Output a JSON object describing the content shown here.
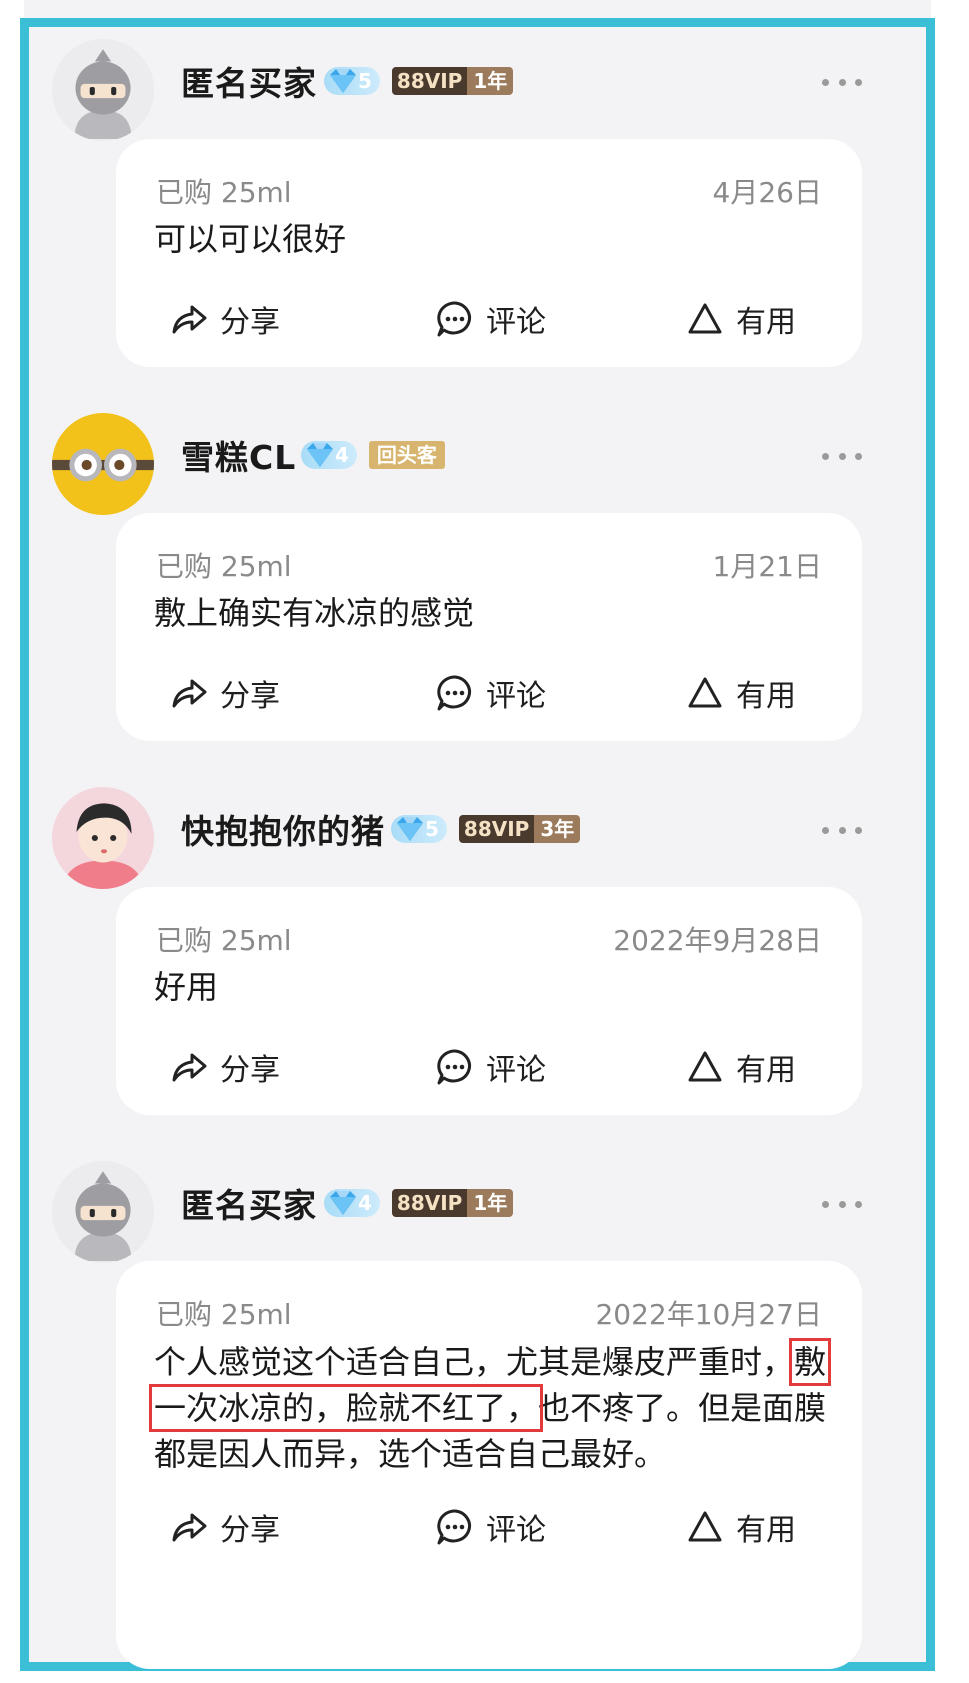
{
  "reviews": [
    {
      "username": "匿名买家",
      "diamond_level": "5",
      "vip_label": "88VIP",
      "vip_years": "1年",
      "purchase": "已购 25ml",
      "date": "4月26日",
      "text_parts": [
        "可以可以很好"
      ],
      "actions": {
        "share": "分享",
        "comment": "评论",
        "useful": "有用"
      }
    },
    {
      "username": "雪糕CL",
      "diamond_level": "4",
      "repeat_label": "回头客",
      "purchase": "已购 25ml",
      "date": "1月21日",
      "text_parts": [
        "敷上确实有冰凉的感觉"
      ],
      "actions": {
        "share": "分享",
        "comment": "评论",
        "useful": "有用"
      }
    },
    {
      "username": "快抱抱你的猪",
      "diamond_level": "5",
      "vip_label": "88VIP",
      "vip_years": "3年",
      "purchase": "已购 25ml",
      "date": "2022年9月28日",
      "text_parts": [
        "好用"
      ],
      "actions": {
        "share": "分享",
        "comment": "评论",
        "useful": "有用"
      }
    },
    {
      "username": "匿名买家",
      "diamond_level": "4",
      "vip_label": "88VIP",
      "vip_years": "1年",
      "purchase": "已购 25ml",
      "date": "2022年10月27日",
      "text_parts": [
        "个人感觉这个适合自己，尤其是爆皮严重时，",
        "敷一次冰凉的，脸就不红了，",
        "也不疼了。但是面膜都是因人而异，选个适合自己最好。"
      ],
      "actions": {
        "share": "分享",
        "comment": "评论",
        "useful": "有用"
      }
    }
  ],
  "colors": {
    "frame_border": "#3bbfd6",
    "highlight_box": "#e23b3b",
    "diamond_badge": "#a9dcf7",
    "vip_dark": "#4a3a2e",
    "repeat_customer": "#d8b56e"
  },
  "icons": {
    "share": "share-arrow-icon",
    "comment": "comment-bubble-icon",
    "useful": "thumb-triangle-icon",
    "more": "more-dots-icon",
    "diamond": "diamond-icon"
  }
}
